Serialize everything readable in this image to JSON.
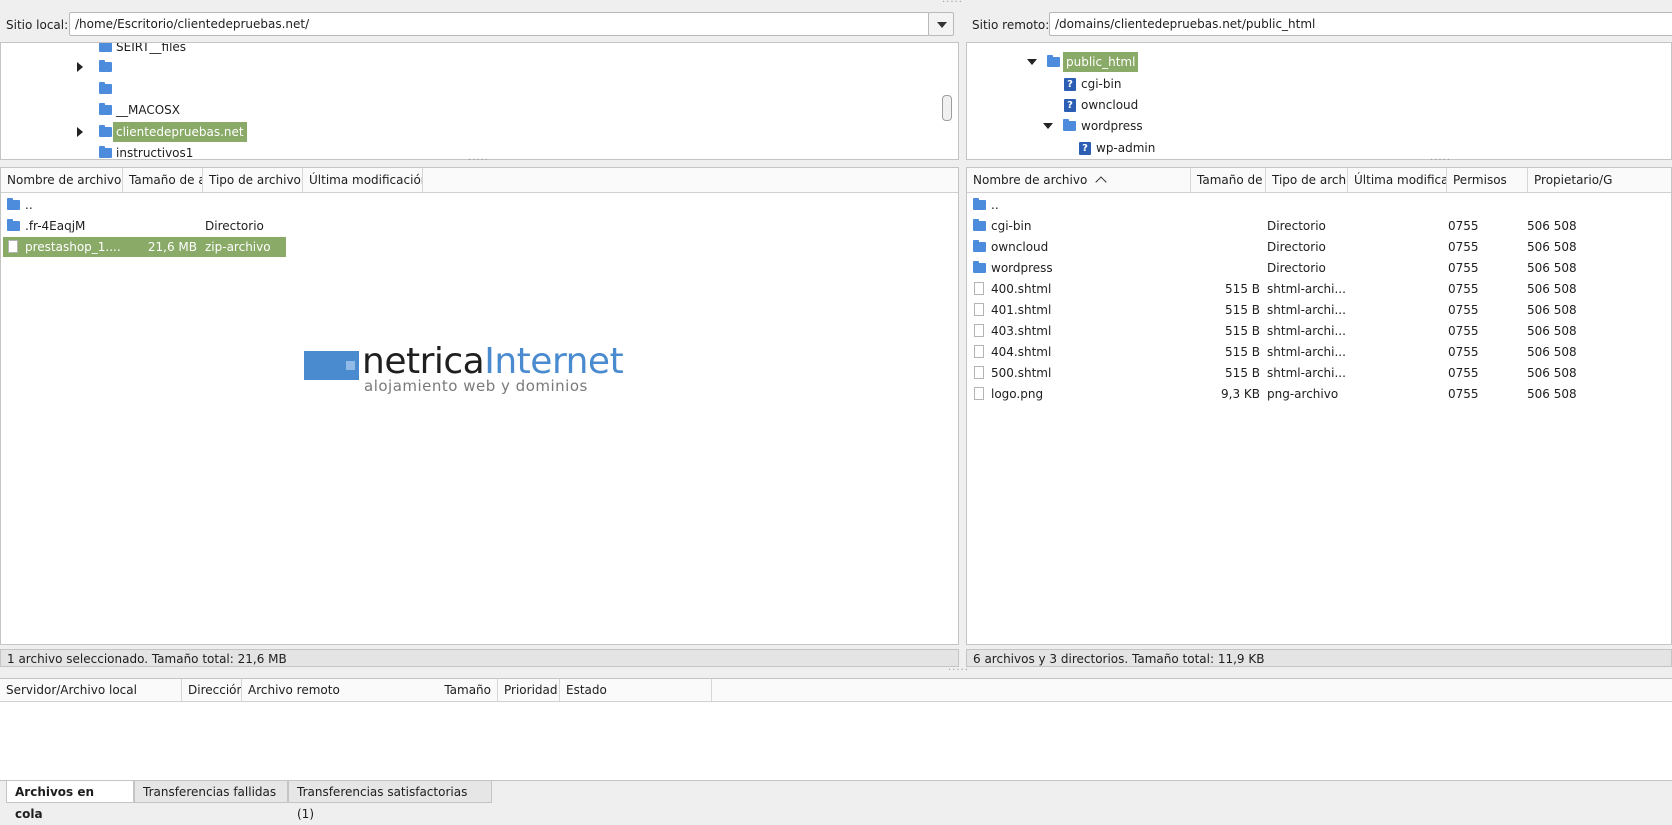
{
  "local": {
    "site_label": "Sitio local:",
    "path": "/home/Escritorio/clientedepruebas.net/",
    "tree": [
      {
        "name": "SEIRT__files",
        "expander": "none",
        "indent": 0
      },
      {
        "name": "",
        "expander": "right",
        "indent": 0
      },
      {
        "name": "",
        "expander": "none",
        "indent": 0
      },
      {
        "name": "__MACOSX",
        "expander": "none",
        "indent": 0
      },
      {
        "name": "clientedepruebas.net",
        "expander": "right",
        "indent": 0,
        "selected": true
      },
      {
        "name": "instructivos1",
        "expander": "none",
        "indent": 0
      }
    ],
    "columns": [
      "Nombre de archivo",
      "Tamaño de a",
      "Tipo de archivo",
      "Última modificación"
    ],
    "files": [
      {
        "name": "..",
        "size": "",
        "type": "",
        "icon": "folder-icon"
      },
      {
        "name": ".fr-4EaqjM",
        "size": "",
        "type": "Directorio",
        "icon": "folder-icon"
      },
      {
        "name": "prestashop_1....",
        "size": "21,6 MB",
        "type": "zip-archivo",
        "icon": "file-icon",
        "selected": true
      }
    ],
    "status": "1 archivo seleccionado. Tamaño total: 21,6 MB"
  },
  "remote": {
    "site_label": "Sitio remoto:",
    "path": "/domains/clientedepruebas.net/public_html",
    "tree": [
      {
        "name": "public_html",
        "kind": "folder",
        "expander": "down",
        "level": 0,
        "selected": true
      },
      {
        "name": "cgi-bin",
        "kind": "unknown",
        "expander": "none",
        "level": 1
      },
      {
        "name": "owncloud",
        "kind": "unknown",
        "expander": "none",
        "level": 1
      },
      {
        "name": "wordpress",
        "kind": "folder",
        "expander": "down",
        "level": 1
      },
      {
        "name": "wp-admin",
        "kind": "unknown",
        "expander": "none",
        "level": 2
      }
    ],
    "columns": [
      "Nombre de archivo",
      "Tamaño de a",
      "Tipo de archiv",
      "Última modificac",
      "Permisos",
      "Propietario/G"
    ],
    "files": [
      {
        "name": "..",
        "size": "",
        "type": "",
        "perm": "",
        "owner": "",
        "icon": "folder-icon"
      },
      {
        "name": "cgi-bin",
        "size": "",
        "type": "Directorio",
        "perm": "0755",
        "owner": "506 508",
        "icon": "folder-icon"
      },
      {
        "name": "owncloud",
        "size": "",
        "type": "Directorio",
        "perm": "0755",
        "owner": "506 508",
        "icon": "folder-icon"
      },
      {
        "name": "wordpress",
        "size": "",
        "type": "Directorio",
        "perm": "0755",
        "owner": "506 508",
        "icon": "folder-icon"
      },
      {
        "name": "400.shtml",
        "size": "515 B",
        "type": "shtml-archi...",
        "perm": "0755",
        "owner": "506 508",
        "icon": "file-icon"
      },
      {
        "name": "401.shtml",
        "size": "515 B",
        "type": "shtml-archi...",
        "perm": "0755",
        "owner": "506 508",
        "icon": "file-icon"
      },
      {
        "name": "403.shtml",
        "size": "515 B",
        "type": "shtml-archi...",
        "perm": "0755",
        "owner": "506 508",
        "icon": "file-icon"
      },
      {
        "name": "404.shtml",
        "size": "515 B",
        "type": "shtml-archi...",
        "perm": "0755",
        "owner": "506 508",
        "icon": "file-icon"
      },
      {
        "name": "500.shtml",
        "size": "515 B",
        "type": "shtml-archi...",
        "perm": "0755",
        "owner": "506 508",
        "icon": "file-icon"
      },
      {
        "name": "logo.png",
        "size": "9,3 KB",
        "type": "png-archivo",
        "perm": "0755",
        "owner": "506 508",
        "icon": "file-icon"
      }
    ],
    "status": "6 archivos y 3 directorios. Tamaño total: 11,9 KB"
  },
  "logo": {
    "word1": "netrica",
    "word2": "Internet",
    "tagline": "alojamiento web y dominios"
  },
  "queue": {
    "columns": [
      "Servidor/Archivo local",
      "Dirección",
      "Archivo remoto",
      "Tamaño",
      "Prioridad",
      "Estado"
    ],
    "tabs": [
      "Archivos en cola",
      "Transferencias fallidas",
      "Transferencias satisfactorias (1)"
    ]
  },
  "colors": {
    "selection": "#8aaa68",
    "folder": "#4d8cdc",
    "unknown": "#2c5fb4"
  }
}
